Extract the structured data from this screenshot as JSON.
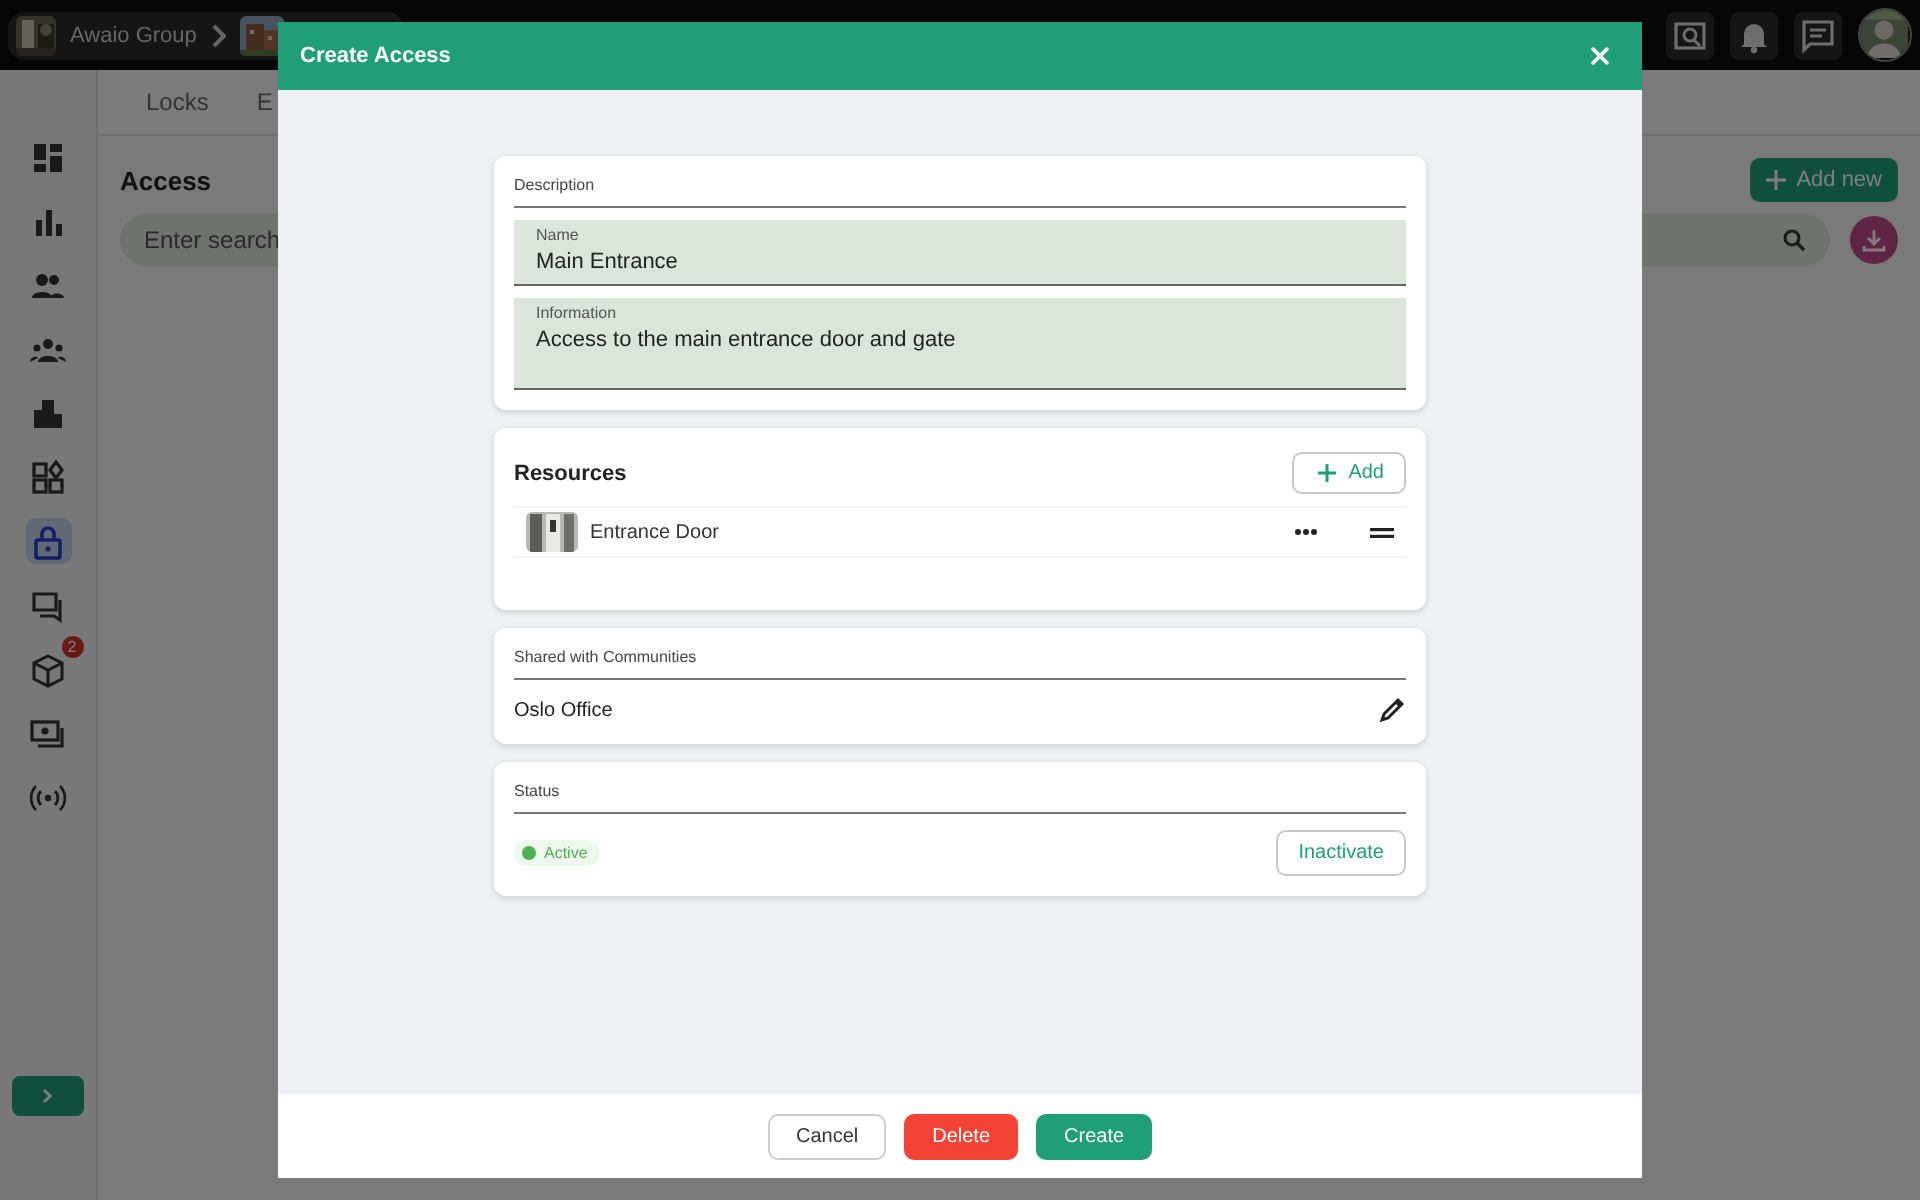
{
  "topbar": {
    "breadcrumbs": [
      {
        "label": "Awaio Group"
      }
    ]
  },
  "sidebar": {
    "items": [
      {
        "kind": "dashboard",
        "selected": false
      },
      {
        "kind": "chart",
        "selected": false
      },
      {
        "kind": "people",
        "selected": false
      },
      {
        "kind": "group",
        "selected": false
      },
      {
        "kind": "buildings",
        "selected": false
      },
      {
        "kind": "widgets",
        "selected": false
      },
      {
        "kind": "lock",
        "selected": true
      },
      {
        "kind": "chat",
        "selected": false
      },
      {
        "kind": "box",
        "selected": false,
        "badge": "2"
      },
      {
        "kind": "money",
        "selected": false
      },
      {
        "kind": "signal",
        "selected": false
      }
    ]
  },
  "tabs": [
    {
      "label": "Locks"
    },
    {
      "label": "E"
    }
  ],
  "page": {
    "title": "Access",
    "add_button": "Add new",
    "search": {
      "placeholder": "Enter search"
    }
  },
  "dialog": {
    "title": "Create Access",
    "description": {
      "heading": "Description",
      "fields": [
        {
          "kind": "line",
          "label": "Name",
          "value": "Main Entrance"
        },
        {
          "kind": "multiline",
          "label": "Information",
          "value": "Access to the main entrance door and gate"
        }
      ]
    },
    "resources": {
      "title": "Resources",
      "add_button": "Add",
      "items": [
        {
          "name": "Entrance Door"
        }
      ]
    },
    "shared": {
      "heading": "Shared with Communities",
      "value": "Oslo Office"
    },
    "status": {
      "heading": "Status",
      "value": "Active",
      "active": true,
      "button": "Inactivate"
    },
    "buttons": [
      {
        "kind": "outline",
        "label": "Cancel"
      },
      {
        "kind": "danger",
        "label": "Delete"
      },
      {
        "kind": "primary",
        "label": "Create"
      }
    ]
  }
}
